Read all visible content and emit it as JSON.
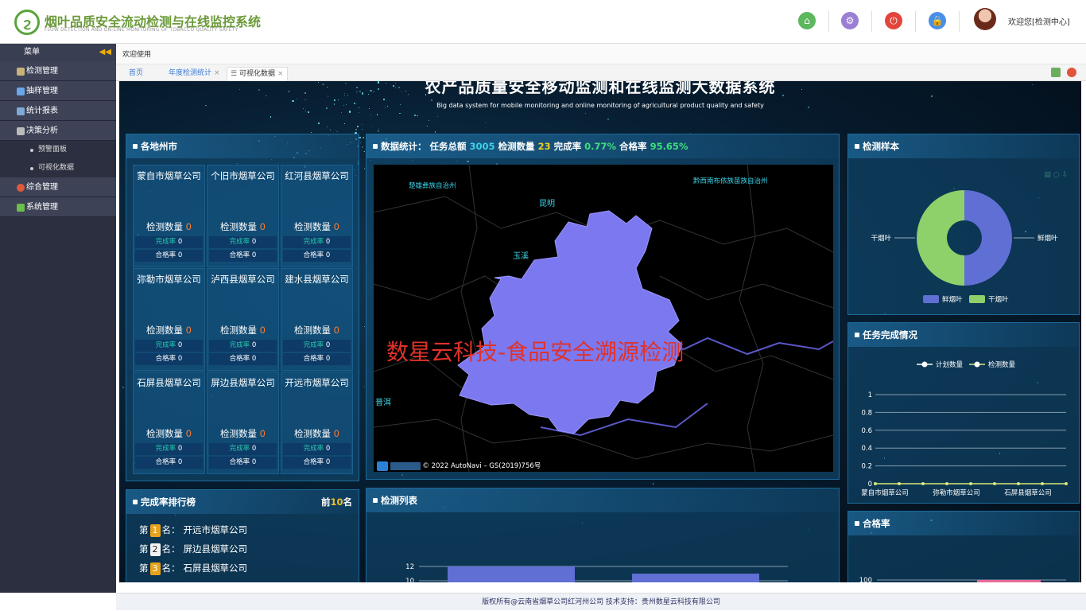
{
  "app": {
    "title": "烟叶品质安全流动检测与在线监控系统",
    "subtitle": "FLOW DETECTION AND ON-LINE MONITORING OF TOBACCO QUALITY SAFETY",
    "user_greeting": "欢迎您[检测中心]"
  },
  "header_icons": [
    "home-icon",
    "settings-icon",
    "power-icon",
    "lock-icon"
  ],
  "colors": {
    "home": "#5cb85c",
    "settings": "#9b7fd4",
    "power": "#e2453c",
    "lock": "#4a8fe7",
    "accent": "#3ad3e8",
    "map_fill": "#7b78f0",
    "fresh": "#5f6fd4",
    "dry": "#8ed06a"
  },
  "sidebar": {
    "head": "菜单",
    "items": [
      {
        "label": "检测管理",
        "icon": "hourglass-icon"
      },
      {
        "label": "抽样管理",
        "icon": "clipboard-icon"
      },
      {
        "label": "统计报表",
        "icon": "bar-chart-icon"
      },
      {
        "label": "决策分析",
        "icon": "document-icon"
      },
      {
        "label": "预警面板",
        "sub": true
      },
      {
        "label": "可视化数据",
        "sub": true
      },
      {
        "label": "综合管理",
        "icon": "alert-icon"
      },
      {
        "label": "系统管理",
        "icon": "puzzle-icon"
      }
    ]
  },
  "topbar": {
    "welcome": "欢迎使用"
  },
  "tabs": [
    {
      "label": "首页",
      "closable": false
    },
    {
      "label": "年度检测统计",
      "closable": true
    },
    {
      "label": "可视化数据",
      "closable": true
    }
  ],
  "dashboard": {
    "title": "农产品质量安全移动监测和在线监测大数据系统",
    "subtitle": "Big data system for mobile monitoring and online monitoring of agricultural product quality and safety",
    "cities_title": "各地州市",
    "count_label": "检测数量",
    "completion_label": "完成率",
    "pass_label": "合格率",
    "cities": [
      {
        "name": "蒙自市烟草公司",
        "count": "0",
        "completion": "0",
        "pass": "0"
      },
      {
        "name": "个旧市烟草公司",
        "count": "0",
        "completion": "0",
        "pass": "0"
      },
      {
        "name": "红河县烟草公司",
        "count": "0",
        "completion": "0",
        "pass": "0"
      },
      {
        "name": "弥勒市烟草公司",
        "count": "0",
        "completion": "0",
        "pass": "0"
      },
      {
        "name": "泸西县烟草公司",
        "count": "0",
        "completion": "0",
        "pass": "0"
      },
      {
        "name": "建水县烟草公司",
        "count": "0",
        "completion": "0",
        "pass": "0"
      },
      {
        "name": "石屏县烟草公司",
        "count": "0",
        "completion": "0",
        "pass": "0"
      },
      {
        "name": "屏边县烟草公司",
        "count": "0",
        "completion": "0",
        "pass": "0"
      },
      {
        "name": "开远市烟草公司",
        "count": "0",
        "completion": "0",
        "pass": "0"
      }
    ],
    "stats": {
      "prefix": "数据统计：",
      "task_label": "任务总额",
      "task_value": "3005",
      "count_label": "检测数量",
      "count_value": "23",
      "completion_label": "完成率",
      "completion_value": "0.77%",
      "pass_label": "合格率",
      "pass_value": "95.65%"
    },
    "map": {
      "labels": [
        "楚雄彝族自治州",
        "昆明",
        "黔西南布依族苗族自治州",
        "玉溪",
        "普洱"
      ],
      "watermark": "数星云科技-食品安全溯源检测",
      "copyright": "© 2022 AutoNavi – GS(2019)756号"
    },
    "ranking": {
      "title": "完成率排行榜",
      "top_prefix": "前",
      "top_n": "10",
      "top_suffix": "名",
      "items": [
        {
          "rank": "1",
          "name": "开远市烟草公司",
          "color": "#e8a21a"
        },
        {
          "rank": "2",
          "name": "屏边县烟草公司",
          "color": "#f2f2f2"
        },
        {
          "rank": "3",
          "name": "石屏县烟草公司",
          "color": "#e8a21a"
        }
      ],
      "pre": "第",
      "post": "名："
    },
    "detect_list_title": "检测列表",
    "sample_title": "检测样本",
    "task_title": "任务完成情况",
    "pass_rate_title": "合格率"
  },
  "chart_data": [
    {
      "type": "pie",
      "title": "检测样本",
      "categories": [
        "鲜烟叶",
        "干烟叶"
      ],
      "values": [
        50,
        50
      ],
      "legend": "bottom"
    },
    {
      "type": "line",
      "title": "任务完成情况",
      "legend": "top",
      "categories": [
        "蒙自市烟草公司",
        "弥勒市烟草公司",
        "石屏县烟草公司"
      ],
      "y_ticks": [
        "1",
        "0.8",
        "0.6",
        "0.4",
        "0.2",
        "0"
      ],
      "ylim": [
        0,
        1
      ],
      "series": [
        {
          "name": "计划数量",
          "values": [
            0,
            0,
            0,
            0,
            0,
            0,
            0,
            0,
            0
          ]
        },
        {
          "name": "检测数量",
          "values": [
            0,
            0,
            0,
            0,
            0,
            0,
            0,
            0,
            0
          ]
        }
      ]
    },
    {
      "type": "bar",
      "title": "检测列表",
      "y_ticks": [
        "12",
        "10"
      ],
      "values": [
        12,
        11
      ]
    },
    {
      "type": "bar",
      "title": "合格率",
      "y_ticks": [
        "100"
      ],
      "values": [
        100
      ]
    }
  ],
  "footer": "版权所有@云南省烟草公司红河州公司 技术支持：贵州数星云科技有限公司"
}
